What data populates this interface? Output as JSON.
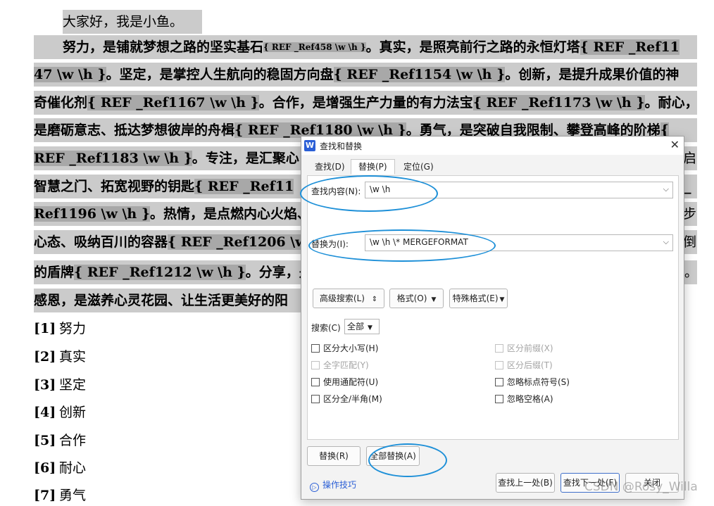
{
  "document": {
    "greeting": "大家好，我是小鱼。",
    "lines": [
      {
        "pre": "努力，是铺就梦想之路的坚实基石",
        "field_small": "{ REF _Ref458 \\w \\h }",
        "post": "。真实，是照亮前行之路的永恒灯塔",
        "field": "{ REF _Ref11"
      },
      {
        "field_start": "47 \\w \\h }",
        "post": "。坚定，是掌控人生航向的稳固方向盘",
        "field": "{ REF _Ref1154 \\w \\h }",
        "post2": "。创新，是提升成果价值的神"
      },
      {
        "pre": "奇催化剂",
        "field": "{ REF _Ref1167 \\w \\h }",
        "post": "。合作，是增强生产力量的有力法宝",
        "field2": "{ REF _Ref1173 \\w \\h }",
        "post2": "。耐心，"
      },
      {
        "pre": "是磨砺意志、抵达梦想彼岸的舟楫",
        "field": "{ REF _Ref1180 \\w \\h }",
        "post": "。勇气，是突破自我限制、攀登高峰的阶梯",
        "field2": "{"
      },
      {
        "field_start": "REF _Ref1183 \\w \\h }",
        "post": "。专注，是汇聚心"
      },
      {
        "pre": "智慧之门、拓宽视野的钥匙",
        "field": "{ REF _Ref11"
      },
      {
        "field_start": "Ref1196 \\w \\h }",
        "post": "。热情，是点燃内心火焰、"
      },
      {
        "pre": "心态、吸纳百川的容器",
        "field": "{ REF _Ref1206 \\w"
      },
      {
        "pre": "的盾牌",
        "field": "{ REF _Ref1212 \\w \\h }",
        "post": "。分享，是"
      },
      {
        "pre": "感恩，是滋养心灵花园、让生活更美好的阳"
      }
    ],
    "right_edge": [
      "启",
      "_",
      "步",
      "倒",
      "。"
    ],
    "bibliography": [
      {
        "num": "[1]",
        "text": "努力"
      },
      {
        "num": "[2]",
        "text": "真实"
      },
      {
        "num": "[3]",
        "text": "坚定"
      },
      {
        "num": "[4]",
        "text": "创新"
      },
      {
        "num": "[5]",
        "text": "合作"
      },
      {
        "num": "[6]",
        "text": "耐心"
      },
      {
        "num": "[7]",
        "text": "勇气"
      }
    ]
  },
  "dialog": {
    "app_icon": "W",
    "title": "查找和替换",
    "close_icon": "✕",
    "tabs": [
      {
        "label": "查找(D)",
        "active": false
      },
      {
        "label": "替换(P)",
        "active": true
      },
      {
        "label": "定位(G)",
        "active": false
      }
    ],
    "find_label": "查找内容(N):",
    "find_value": "\\w \\h",
    "replace_label": "替换为(I):",
    "replace_value": "\\w \\h \\* MERGEFORMAT",
    "advanced_search": "高级搜索(L)",
    "advanced_icon": "⇕",
    "format": "格式(O)",
    "special": "特殊格式(E)",
    "search_label": "搜索(C)",
    "search_value": "全部",
    "options_left": [
      {
        "label": "区分大小写(H)",
        "disabled": false
      },
      {
        "label": "全字匹配(Y)",
        "disabled": true
      },
      {
        "label": "使用通配符(U)",
        "disabled": false
      },
      {
        "label": "区分全/半角(M)",
        "disabled": false
      }
    ],
    "options_right": [
      {
        "label": "区分前缀(X)",
        "disabled": true
      },
      {
        "label": "区分后缀(T)",
        "disabled": true
      },
      {
        "label": "忽略标点符号(S)",
        "disabled": false
      },
      {
        "label": "忽略空格(A)",
        "disabled": false
      }
    ],
    "replace_btn": "替换(R)",
    "replace_all_btn": "全部替换(A)",
    "tips_icon": "▷",
    "tips": "操作技巧",
    "find_prev": "查找上一处(B)",
    "find_next": "查找下一处(F)",
    "close_btn": "关闭"
  },
  "watermark": "CSDN @Rosy_Willa",
  "colors": {
    "field_gray": "#a8a8a8",
    "highlight_gray": "#cbcbcb",
    "annotation_blue": "#1e90d8",
    "accent": "#2b5fd6"
  }
}
